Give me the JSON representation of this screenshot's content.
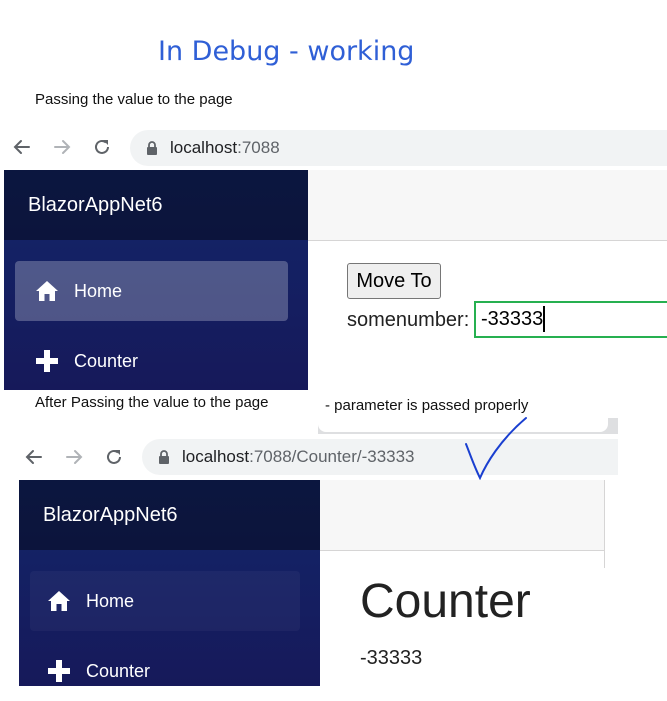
{
  "heading": "In Debug - working",
  "caption_before": "Passing the value to the page",
  "caption_after": "After Passing the value to the page",
  "caption_note": "- parameter is passed properly",
  "browser1": {
    "url_host": "localhost",
    "url_rest": ":7088"
  },
  "browser2": {
    "url_host": "localhost",
    "url_rest": ":7088/Counter/-33333"
  },
  "app": {
    "brand": "BlazorAppNet6",
    "nav": [
      {
        "label": "Home",
        "icon": "home-icon"
      },
      {
        "label": "Counter",
        "icon": "plus-icon"
      }
    ]
  },
  "form": {
    "button_label": "Move To",
    "field_label": "somenumber:",
    "field_value": "-33333"
  },
  "counter_page": {
    "title": "Counter",
    "value": "-33333"
  },
  "colors": {
    "heading": "#2f5fd6",
    "input_border": "#26b050",
    "checkmark": "#1a3fd0"
  }
}
